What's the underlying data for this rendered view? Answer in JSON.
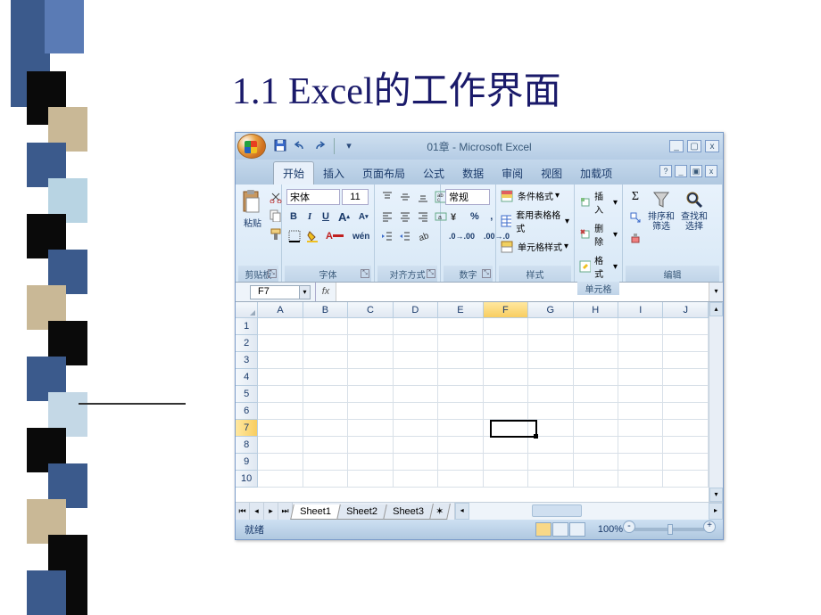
{
  "slide": {
    "title": "1.1 Excel的工作界面"
  },
  "window": {
    "title": "01章 - Microsoft Excel",
    "controls": {
      "min": "_",
      "max": "▢",
      "close": "x"
    }
  },
  "qat": {
    "save": "💾",
    "undo": "↶",
    "redo": "↷"
  },
  "tabs": [
    "开始",
    "插入",
    "页面布局",
    "公式",
    "数据",
    "审阅",
    "视图",
    "加载项"
  ],
  "activeTab": "开始",
  "ribbon": {
    "clipboard": {
      "label": "剪贴板",
      "paste": "粘贴"
    },
    "font": {
      "label": "字体",
      "name": "宋体",
      "size": "11",
      "bold": "B",
      "italic": "I",
      "underline": "U",
      "grow": "A",
      "shrink": "A"
    },
    "align": {
      "label": "对齐方式"
    },
    "number": {
      "label": "数字",
      "format": "常规",
      "currency": "¥",
      "percent": "%",
      "comma": ","
    },
    "styles": {
      "label": "样式",
      "cond": "条件格式",
      "table": "套用表格格式",
      "cell": "单元格样式"
    },
    "cells": {
      "label": "单元格",
      "insert": "插入",
      "delete": "删除",
      "format": "格式"
    },
    "editing": {
      "label": "编辑",
      "sort": "排序和\n筛选",
      "find": "查找和\n选择"
    }
  },
  "namebox": "F7",
  "columns": [
    "A",
    "B",
    "C",
    "D",
    "E",
    "F",
    "G",
    "H",
    "I",
    "J"
  ],
  "rows": [
    1,
    2,
    3,
    4,
    5,
    6,
    7,
    8,
    9,
    10
  ],
  "selectedCell": {
    "col": "F",
    "row": 7
  },
  "sheets": [
    "Sheet1",
    "Sheet2",
    "Sheet3"
  ],
  "activeSheet": "Sheet1",
  "status": {
    "ready": "就绪",
    "zoom": "100%"
  }
}
